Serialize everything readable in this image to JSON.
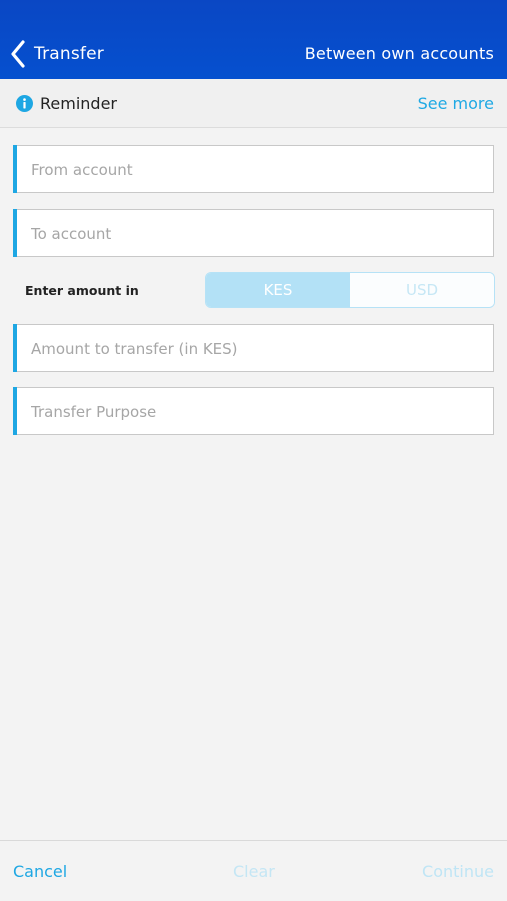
{
  "header": {
    "back_label": "Transfer",
    "right_title": "Between own accounts"
  },
  "reminder": {
    "label": "Reminder",
    "link": "See more"
  },
  "form": {
    "from_account_placeholder": "From account",
    "to_account_placeholder": "To account",
    "amount_label": "Enter amount in",
    "currency_options": [
      "KES",
      "USD"
    ],
    "selected_currency": "KES",
    "amount_placeholder": "Amount to transfer (in KES)",
    "purpose_placeholder": "Transfer Purpose"
  },
  "footer": {
    "cancel_label": "Cancel",
    "clear_label": "Clear",
    "continue_label": "Continue"
  },
  "colors": {
    "header_blue": "#0a47c4",
    "accent_blue": "#1ea7e3",
    "selected_segment": "#b3e1f6"
  }
}
